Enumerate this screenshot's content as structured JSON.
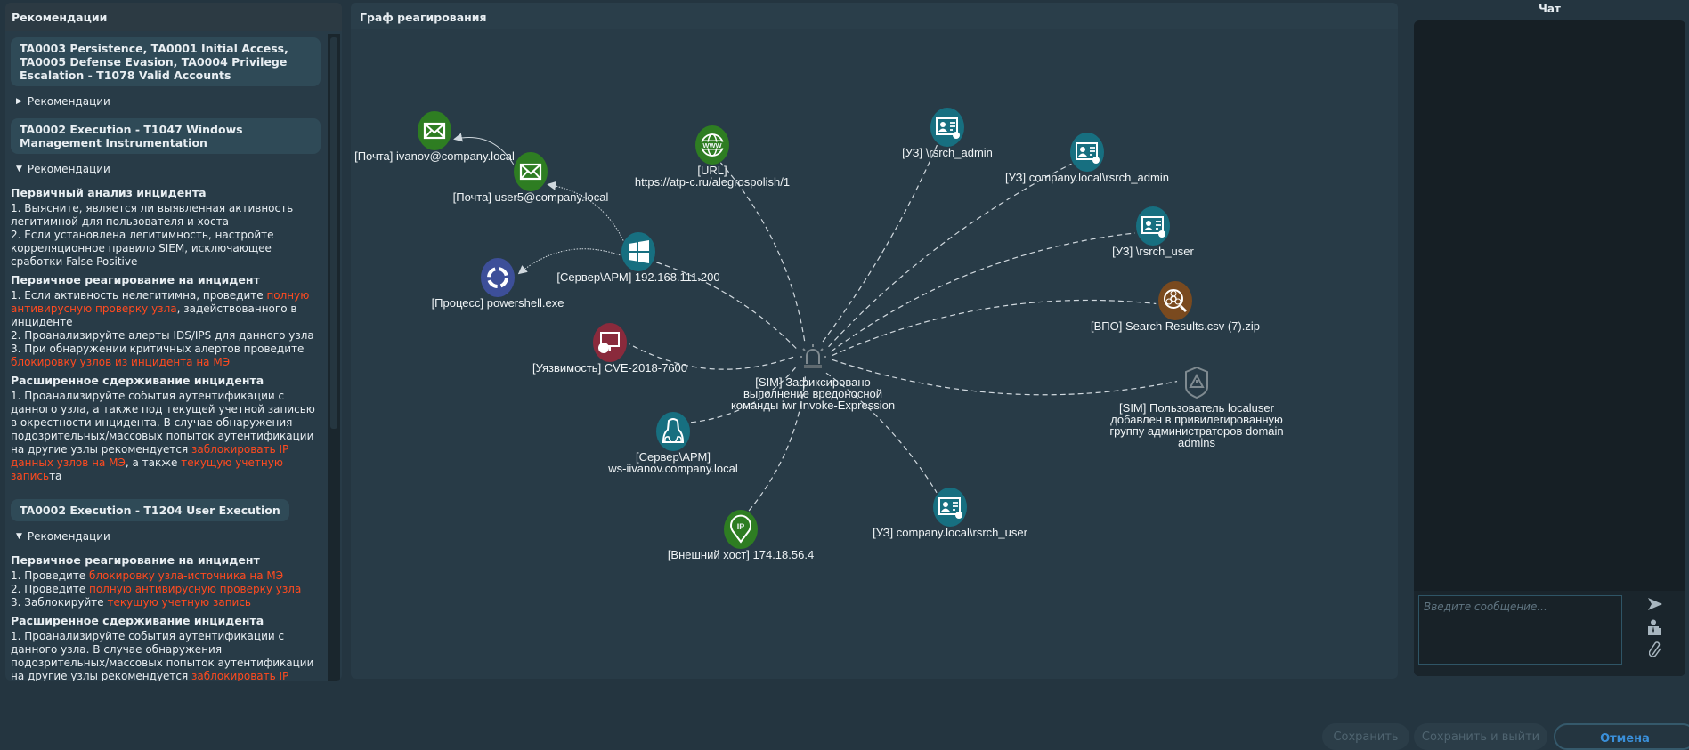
{
  "left": {
    "title": "Рекомендации",
    "blocks": [
      {
        "card": "TA0003 Persistence, TA0001 Initial Access, TA0005 Defense Evasion, TA0004 Privilege Escalation - T1078 Valid Accounts",
        "toggle": "Рекомендации",
        "expanded": false,
        "sections": []
      },
      {
        "card": "TA0002 Execution - T1047 Windows Management Instrumentation",
        "toggle": "Рекомендации",
        "expanded": true,
        "sections": [
          {
            "heading": "Первичный анализ инцидента",
            "lines": [
              [
                {
                  "t": "1. Выясните, является ли выявленная активность легитимной для пользователя и хоста"
                }
              ],
              [
                {
                  "t": "2. Если установлена легитимность, настройте корреляционное правило SIEM, исключающее сработки False Positive"
                }
              ]
            ]
          },
          {
            "heading": "Первичное реагирование на инцидент",
            "lines": [
              [
                {
                  "t": "1. Если активность нелегитимна, проведите "
                },
                {
                  "t": "полную антивирусную проверку узла",
                  "hl": true
                },
                {
                  "t": ", задействованного в инциденте"
                }
              ],
              [
                {
                  "t": "2. Проанализируйте алерты IDS/IPS для данного узла"
                }
              ],
              [
                {
                  "t": "3. При обнаружении критичных алертов проведите "
                },
                {
                  "t": "блокировку узлов из инцидента на МЭ",
                  "hl": true
                }
              ]
            ]
          },
          {
            "heading": "Расширенное сдерживание инцидента",
            "lines": [
              [
                {
                  "t": "1. Проанализируйте события аутентификации с данного узла, а также под текущей учетной записью в окрестности инцидента. В случае обнаружения подозрительных/массовых попыток аутентификации на другие узлы рекомендуется "
                },
                {
                  "t": "заблокировать IP данных узлов на МЭ",
                  "hl": true
                },
                {
                  "t": ", а также "
                },
                {
                  "t": "текущую учетную запись",
                  "hl": true
                },
                {
                  "t": "та"
                }
              ]
            ]
          }
        ]
      },
      {
        "card": "TA0002 Execution - T1204 User Execution",
        "toggle": "Рекомендации",
        "expanded": true,
        "sections": [
          {
            "heading": "Первичное реагирование на инцидент",
            "lines": [
              [
                {
                  "t": "1. Проведите "
                },
                {
                  "t": "блокировку узла-источника на МЭ",
                  "hl": true
                }
              ],
              [
                {
                  "t": "2. Проведите "
                },
                {
                  "t": "полную антивирусную проверку узла",
                  "hl": true
                }
              ],
              [
                {
                  "t": "3. Заблокируйте "
                },
                {
                  "t": "текущую учетную запись",
                  "hl": true
                }
              ]
            ]
          },
          {
            "heading": "Расширенное сдерживание инцидента",
            "lines": [
              [
                {
                  "t": "1. Проанализируйте события аутентификации с данного узла. В случае обнаружения подозрительных/массовых попыток аутентификации на другие узлы рекомендуется "
                },
                {
                  "t": "заблокировать IP",
                  "hl": true
                }
              ]
            ]
          }
        ]
      }
    ]
  },
  "graph": {
    "title": "Граф реагирования",
    "nodes": [
      {
        "id": "sim1",
        "icon": "alarm-icon",
        "color": "#7f8a90",
        "label": [
          "[SIM] Зафиксировано",
          "выполнение вредоносной",
          "команды iwr Invoke-Expression"
        ]
      },
      {
        "id": "mail1",
        "icon": "envelope-icon",
        "color": "#2e7d22",
        "label": [
          "[Почта] ivanov@company.local"
        ]
      },
      {
        "id": "mail2",
        "icon": "envelope-icon",
        "color": "#2e7d22",
        "label": [
          "[Почта] user5@company.local"
        ]
      },
      {
        "id": "url",
        "icon": "globe-icon",
        "color": "#2e7d22",
        "label": [
          "[URL]",
          "https://atp-c.ru/alegrospolish/1"
        ]
      },
      {
        "id": "srv",
        "icon": "windows-icon",
        "color": "#176f80",
        "label": [
          "[Сервер\\АРМ] 192.168.111.200"
        ]
      },
      {
        "id": "proc",
        "icon": "process-icon",
        "color": "#3d4f99",
        "label": [
          "[Процесс] powershell.exe"
        ]
      },
      {
        "id": "cve",
        "icon": "vulnerability-icon",
        "color": "#8a2a3c",
        "label": [
          "[Уязвимость] CVE-2018-7600"
        ]
      },
      {
        "id": "uz1",
        "icon": "account-icon",
        "color": "#176f80",
        "label": [
          "[УЗ] \\rsrch_admin"
        ]
      },
      {
        "id": "uz2",
        "icon": "account-icon",
        "color": "#176f80",
        "label": [
          "[УЗ] company.local\\rsrch_admin"
        ]
      },
      {
        "id": "uz3",
        "icon": "account-icon",
        "color": "#176f80",
        "label": [
          "[УЗ] \\rsrch_user"
        ]
      },
      {
        "id": "vpo",
        "icon": "biohazard-icon",
        "color": "#7a4a1f",
        "label": [
          "[ВПО] Search Results.csv (7).zip"
        ]
      },
      {
        "id": "sim2",
        "icon": "shield-warning-icon",
        "color": "#7f8a90",
        "label": [
          "[SIM] Пользователь localuser",
          "добавлен в привилегированную",
          "группу администраторов domain",
          "admins"
        ]
      },
      {
        "id": "ws",
        "icon": "hacker-icon",
        "color": "#176f80",
        "label": [
          "[Сервер\\АРМ]",
          "ws-iivanov.company.local"
        ]
      },
      {
        "id": "ip",
        "icon": "ip-pin-icon",
        "color": "#2e7d22",
        "label": [
          "[Внешний хост] 174.18.56.4"
        ]
      },
      {
        "id": "uz4",
        "icon": "account-icon",
        "color": "#176f80",
        "label": [
          "[УЗ] company.local\\rsrch_user"
        ]
      }
    ],
    "edges": [
      {
        "from": "sim1",
        "to": "url",
        "style": "dashed"
      },
      {
        "from": "sim1",
        "to": "uz1",
        "style": "dashed"
      },
      {
        "from": "sim1",
        "to": "uz2",
        "style": "dashed"
      },
      {
        "from": "sim1",
        "to": "uz3",
        "style": "dashed"
      },
      {
        "from": "sim1",
        "to": "vpo",
        "style": "dashed"
      },
      {
        "from": "sim1",
        "to": "sim2",
        "style": "dashed"
      },
      {
        "from": "sim1",
        "to": "uz4",
        "style": "dashed"
      },
      {
        "from": "sim1",
        "to": "ip",
        "style": "dashed"
      },
      {
        "from": "sim1",
        "to": "ws",
        "style": "dashed"
      },
      {
        "from": "sim1",
        "to": "cve",
        "style": "dashed"
      },
      {
        "from": "sim1",
        "to": "srv",
        "style": "dashed"
      },
      {
        "from": "srv",
        "to": "mail2",
        "style": "dotted-arrow"
      },
      {
        "from": "srv",
        "to": "proc",
        "style": "dotted-arrow"
      },
      {
        "from": "mail2",
        "to": "mail1",
        "style": "solid-arrow"
      }
    ]
  },
  "chat": {
    "title": "Чат",
    "placeholder": "Введите сообщение...",
    "icons": [
      "send-icon",
      "assign-user-icon",
      "paperclip-icon"
    ]
  },
  "footer": {
    "save": "Сохранить",
    "save_exit": "Сохранить и выйти",
    "cancel": "Отмена",
    "accent": "#3a8fd9"
  }
}
